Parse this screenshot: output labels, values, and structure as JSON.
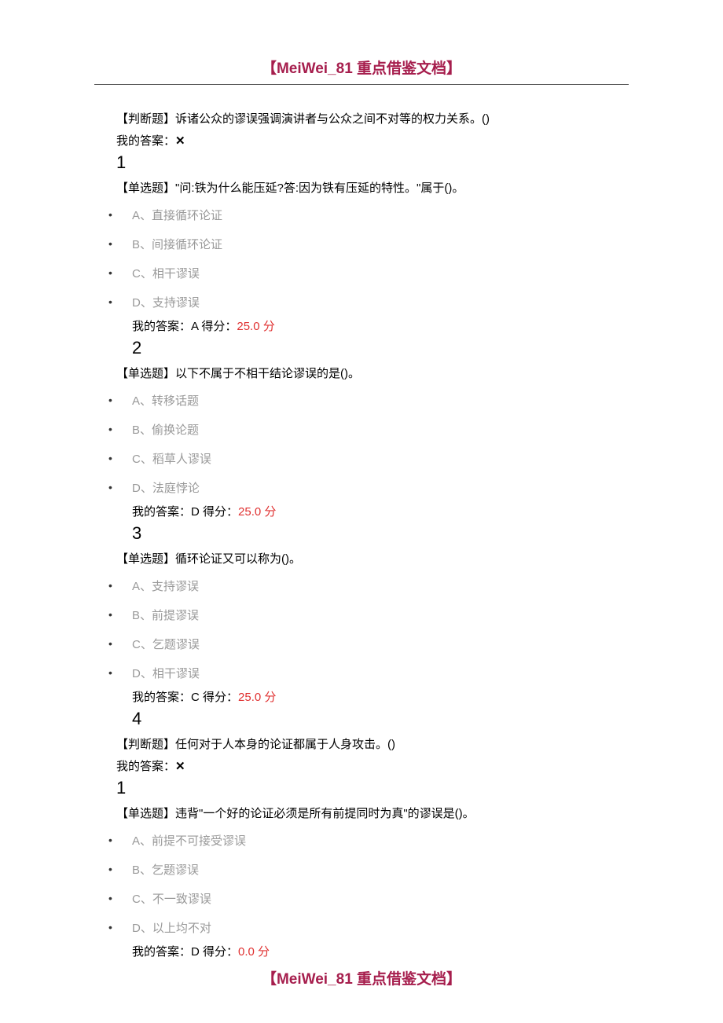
{
  "header": {
    "title": "【MeiWei_81 重点借鉴文档】"
  },
  "footer": {
    "title": "【MeiWei_81 重点借鉴文档】"
  },
  "q0": {
    "type_label": "【判断题】",
    "text": "诉诸公众的谬误强调演讲者与公众之间不对等的权力关系。()",
    "my_answer_label": "我的答案：",
    "mark": "✕"
  },
  "q1": {
    "number": "1",
    "type_label": "【单选题】",
    "text": "\"问:铁为什么能压延?答:因为铁有压延的特性。\"属于()。",
    "options": {
      "a": "A、直接循环论证",
      "b": "B、间接循环论证",
      "c": "C、相干谬误",
      "d": "D、支持谬误"
    },
    "answer_prefix": "我的答案：A 得分：",
    "score": "25.0 分"
  },
  "q2": {
    "number": "2",
    "type_label": "【单选题】",
    "text": "以下不属于不相干结论谬误的是()。",
    "options": {
      "a": "A、转移话题",
      "b": "B、偷换论题",
      "c": "C、稻草人谬误",
      "d": "D、法庭悖论"
    },
    "answer_prefix": "我的答案：D 得分：",
    "score": "25.0 分"
  },
  "q3": {
    "number": "3",
    "type_label": "【单选题】",
    "text": "循环论证又可以称为()。",
    "options": {
      "a": "A、支持谬误",
      "b": "B、前提谬误",
      "c": "C、乞题谬误",
      "d": "D、相干谬误"
    },
    "answer_prefix": "我的答案：C 得分：",
    "score": "25.0 分"
  },
  "q4": {
    "number": "4",
    "type_label": "【判断题】",
    "text": "任何对于人本身的论证都属于人身攻击。()",
    "my_answer_label": "我的答案：",
    "mark": "✕"
  },
  "q5": {
    "number": "1",
    "type_label": "【单选题】",
    "text": "违背\"一个好的论证必须是所有前提同时为真\"的谬误是()。",
    "options": {
      "a": "A、前提不可接受谬误",
      "b": "B、乞题谬误",
      "c": "C、不一致谬误",
      "d": "D、以上均不对"
    },
    "answer_prefix": "我的答案：D 得分：",
    "score": "0.0 分"
  }
}
